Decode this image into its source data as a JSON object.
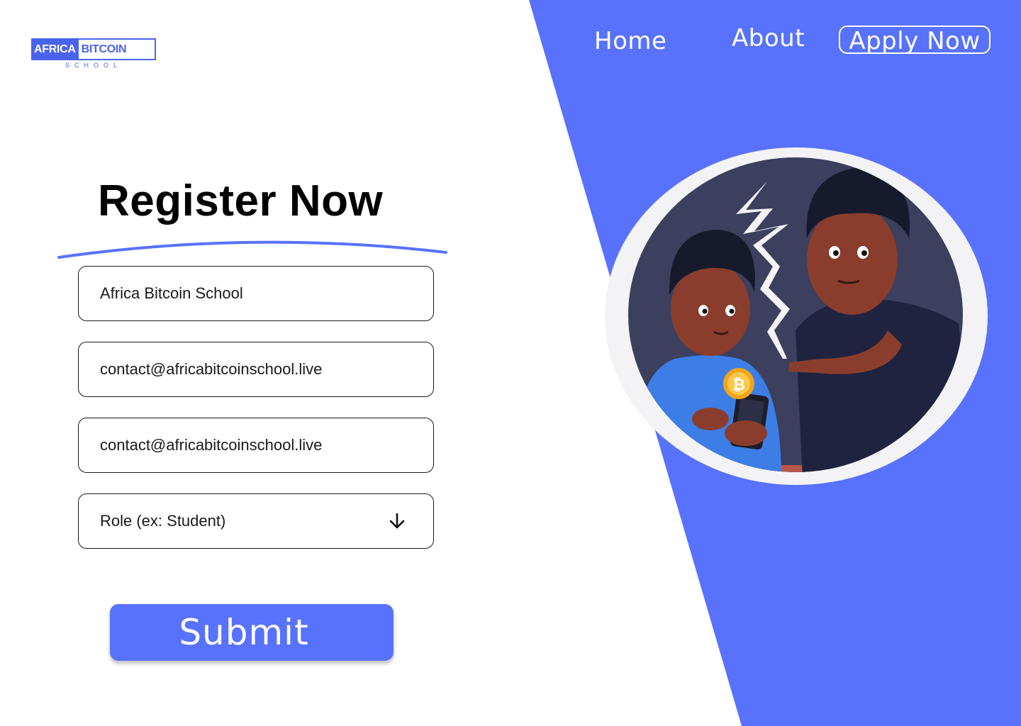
{
  "brand": {
    "logo_part1": "AFRICA",
    "logo_part2": "BITCOIN",
    "logo_sub": "SCHOOL",
    "accent_color": "#5872fd"
  },
  "nav": {
    "home": "Home",
    "about": "About",
    "apply": "Apply Now"
  },
  "form": {
    "heading": "Register Now",
    "name_value": "Africa Bitcoin School",
    "email_value": "contact@africabitcoinschool.live",
    "email_confirm_value": "contact@africabitcoinschool.live",
    "role_placeholder": "Role (ex: Student)",
    "role_icon": "arrow-down-icon",
    "submit_label": "Submit"
  },
  "illustration": {
    "subject": "two-kids-bitcoin-phone",
    "coin_symbol": "₿"
  }
}
